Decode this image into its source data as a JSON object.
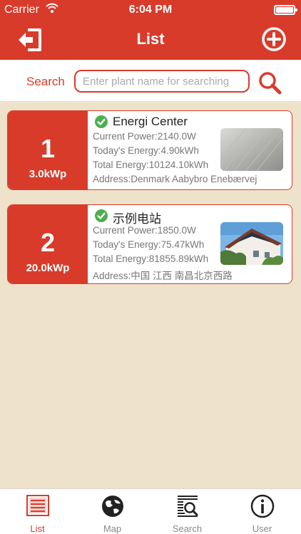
{
  "status_bar": {
    "carrier": "Carrier",
    "time": "6:04 PM"
  },
  "nav": {
    "title": "List"
  },
  "search": {
    "label": "Search",
    "placeholder": "Enter plant name for searching"
  },
  "plants": [
    {
      "index": "1",
      "capacity": "3.0kWp",
      "name": "Energi Center",
      "current_power": "Current Power:2140.0W",
      "today_energy": "Today's Energy:4.90kWh",
      "total_energy": "Total Energy:10124.10kWh",
      "address": "Address:Denmark Aabybro Enebærvej",
      "status": "online",
      "image": "solar-panel-closeup"
    },
    {
      "index": "2",
      "capacity": "20.0kWp",
      "name": "示例电站",
      "current_power": "Current Power:1850.0W",
      "today_energy": "Today's Energy:75.47kWh",
      "total_energy": "Total Energy:81855.89kWh",
      "address": "Address:中国 江西 南昌北京西路",
      "status": "online",
      "image": "house-with-rooftop-solar"
    }
  ],
  "tabs": [
    {
      "label": "List",
      "icon": "list-icon",
      "active": true
    },
    {
      "label": "Map",
      "icon": "globe-icon",
      "active": false
    },
    {
      "label": "Search",
      "icon": "search-list-icon",
      "active": false
    },
    {
      "label": "User",
      "icon": "info-icon",
      "active": false
    }
  ],
  "colors": {
    "brand": "#d93b2b",
    "background": "#efe2cb",
    "status_ok": "#4caf50"
  }
}
